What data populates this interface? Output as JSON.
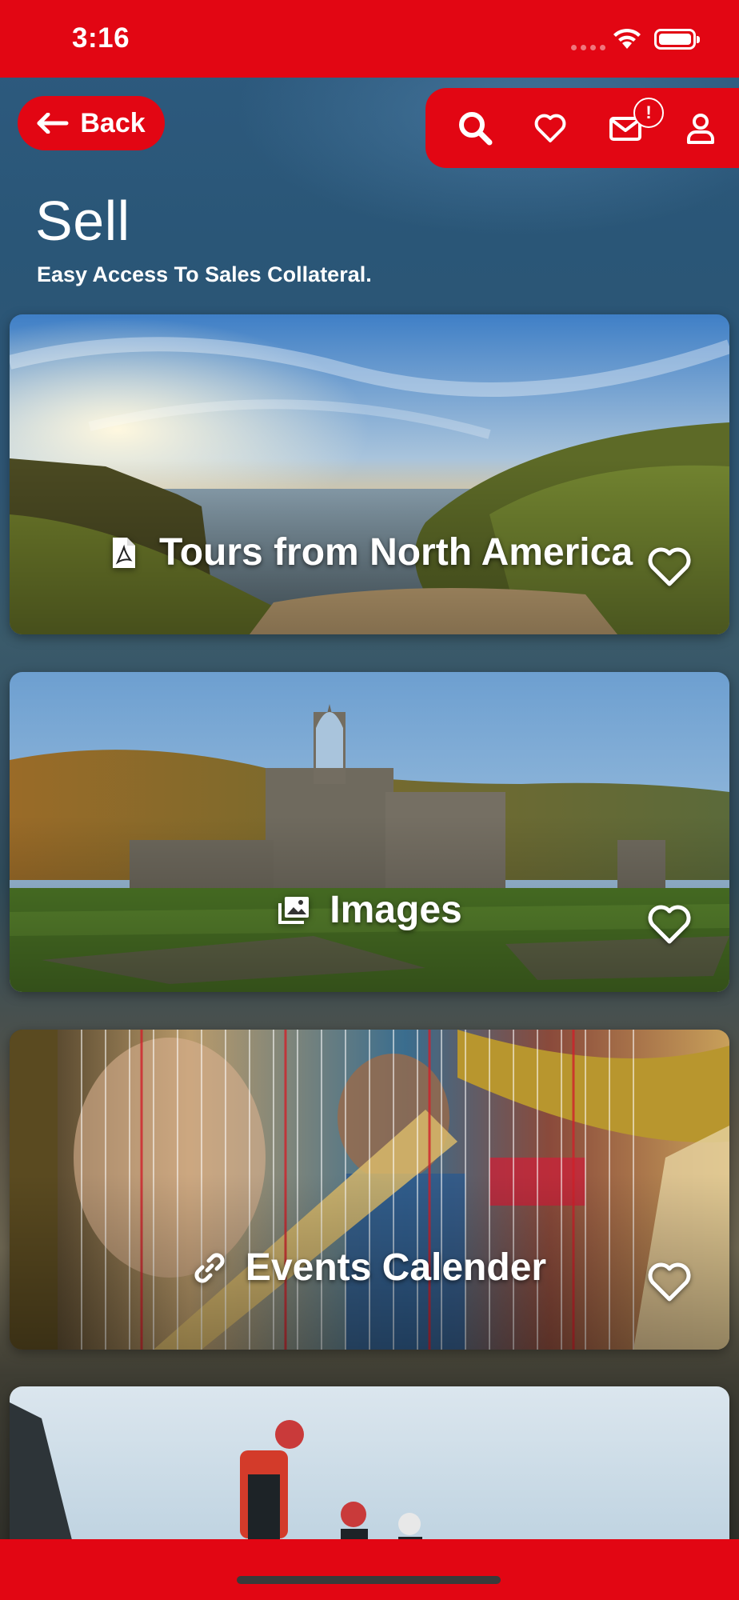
{
  "status_bar": {
    "time": "3:16"
  },
  "nav": {
    "back_label": "Back",
    "notification_badge": "!"
  },
  "header": {
    "title": "Sell",
    "subtitle": "Easy Access To Sales Collateral."
  },
  "cards": [
    {
      "label": "Tours from North America",
      "icon": "pdf-icon"
    },
    {
      "label": "Images",
      "icon": "images-icon"
    },
    {
      "label": "Events Calender",
      "icon": "link-icon"
    },
    {
      "label": "",
      "icon": ""
    }
  ],
  "colors": {
    "brand_red": "#e20613",
    "text": "#ffffff"
  }
}
